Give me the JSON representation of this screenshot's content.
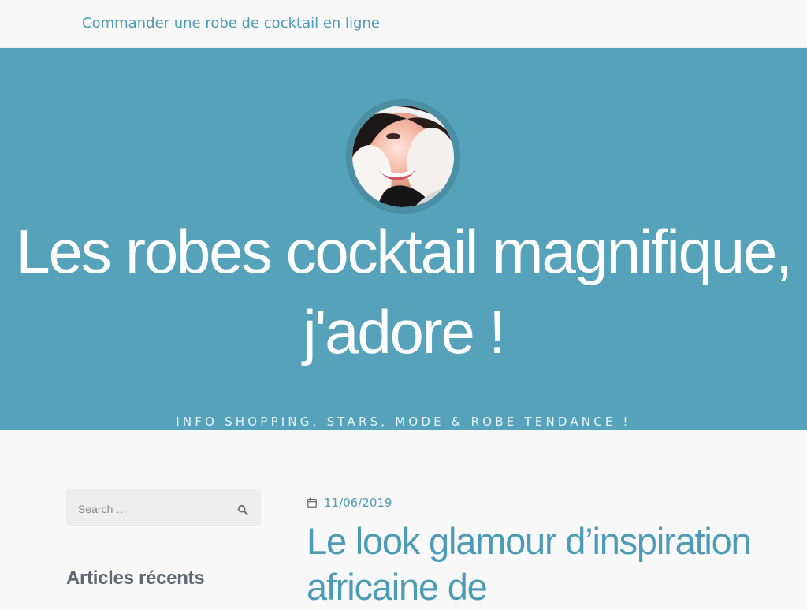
{
  "top_nav": {
    "link": "Commander une robe de cocktail en ligne"
  },
  "hero": {
    "title": "Les robes cocktail magnifique, j'adore !",
    "tagline": "INFO SHOPPING, STARS, MODE & ROBE TENDANCE !"
  },
  "sidebar": {
    "search_placeholder": "Search …",
    "recent_heading": "Articles récents"
  },
  "post": {
    "date": "11/06/2019",
    "title": "Le look glamour d’inspiration africaine de"
  },
  "colors": {
    "accent": "#4d9bb4",
    "hero_background": "#55a2ba"
  }
}
